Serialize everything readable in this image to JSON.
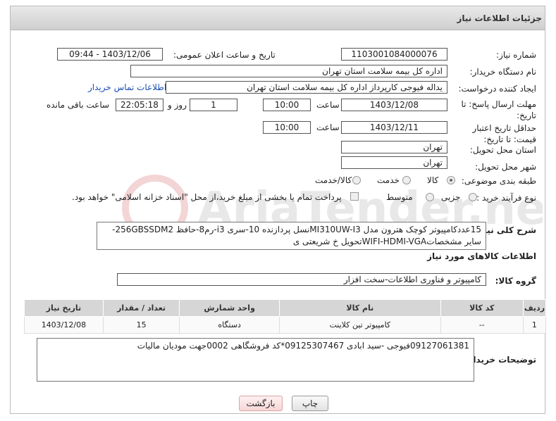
{
  "header": {
    "title": "جزئیات اطلاعات نیاز"
  },
  "fields": {
    "need_number_label": "شماره نیاز:",
    "need_number": "1103001084000076",
    "announce_label": "تاریخ و ساعت اعلان عمومی:",
    "announce_value": "1403/12/06 - 09:44",
    "buyer_org_label": "نام دستگاه خریدار:",
    "buyer_org": "اداره کل بیمه سلامت استان تهران",
    "requester_label": "ایجاد کننده درخواست:",
    "requester": "یداله فیوجی کارپرداز اداره کل بیمه سلامت استان تهران",
    "contact_link": "اطلاعات تماس خریدار",
    "deadline_label": "مهلت ارسال پاسخ: تا تاریخ:",
    "deadline_date": "1403/12/08",
    "time_label": "ساعت",
    "deadline_time": "10:00",
    "days_value": "1",
    "days_label": "روز و",
    "remaining_time": "22:05:18",
    "remaining_label": "ساعت باقی مانده",
    "validity_label": "حداقل تاریخ اعتبار قیمت: تا تاریخ:",
    "validity_date": "1403/12/11",
    "validity_time": "10:00",
    "province_label": "استان محل تحویل:",
    "province": "تهران",
    "city_label": "شهر محل تحویل:",
    "city": "تهران",
    "category_label": "طبقه بندی موضوعی:",
    "category_options": [
      "کالا",
      "خدمت",
      "کالا/خدمت"
    ],
    "process_label": "نوع فرآیند خرید :",
    "process_options": [
      "جزیی",
      "متوسط"
    ],
    "payment_note": "پرداخت تمام یا بخشی از مبلغ خرید،از محل \"اسناد خزانه اسلامی\" خواهد بود.",
    "summary_label": "شرح کلی نیاز:",
    "summary_text": "15عددکامپیوتر کوچک هترون مدل MI310UW-I3نسل پردازنده 10-سری i3-رم8-حافظ 256GBSSDM2-سایر مشخصاتWIFI-HDMI-VGAتحویل خ شریعتی ی",
    "goods_info_title": "اطلاعات کالاهای مورد نیاز",
    "goods_group_label": "گروه کالا:",
    "goods_group": "کامپیوتر و فناوری اطلاعات-سخت افزار",
    "buyer_notes_label": "توضیحات خریدار:",
    "buyer_notes": "09127061381فیوجی -سید ابادی 09125307467*کد فروشگاهی 0002جهت مودیان مالیات"
  },
  "table": {
    "headers": [
      "ردیف",
      "کد کالا",
      "نام کالا",
      "واحد شمارش",
      "تعداد / مقدار",
      "تاریخ نیاز"
    ],
    "rows": [
      [
        "1",
        "--",
        "کامپیوتر تین کلاینت",
        "دستگاه",
        "15",
        "1403/12/08"
      ]
    ]
  },
  "buttons": {
    "print": "چاپ",
    "back": "بازگشت"
  },
  "watermark": "AriaTender.neT"
}
